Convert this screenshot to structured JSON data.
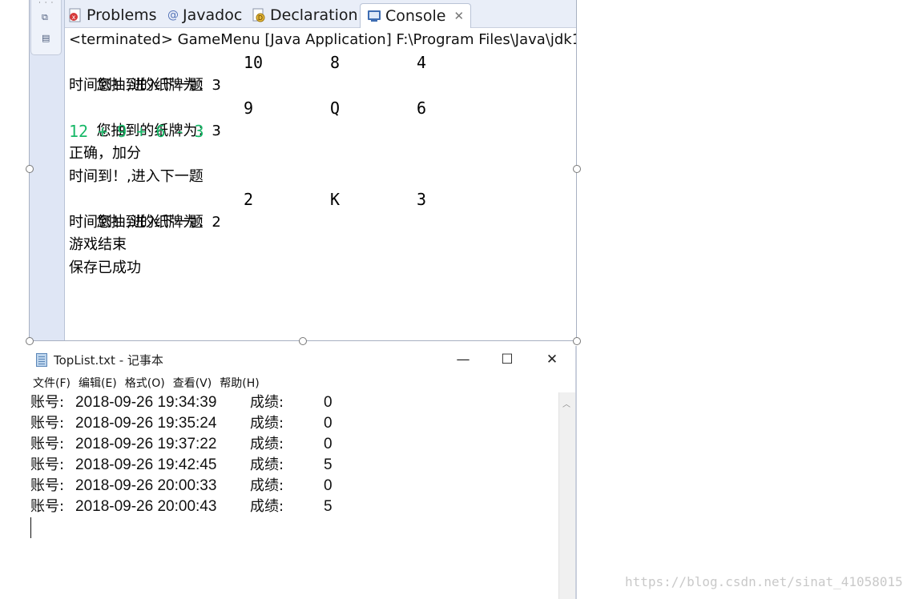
{
  "eclipse": {
    "tabs": [
      {
        "label": "Problems",
        "icon": "problems-icon"
      },
      {
        "label": "Javadoc",
        "icon": "javadoc-icon"
      },
      {
        "label": "Declaration",
        "icon": "declaration-icon"
      },
      {
        "label": "Console",
        "icon": "console-icon",
        "active": true
      }
    ],
    "console_header": "<terminated> GameMenu [Java Application] F:\\Program Files\\Java\\jdk1",
    "console_lines": [
      {
        "text": "您抽到的纸牌为：3",
        "cells": [
          "10",
          "8",
          "4"
        ]
      },
      {
        "text": "时间到！,进入下一题"
      },
      {
        "text": "您抽到的纸牌为：3",
        "cells": [
          "9",
          "Q",
          "6"
        ]
      },
      {
        "text": "12 + 9 + 6 - 3",
        "color": "#18b868"
      },
      {
        "text": "正确，加分"
      },
      {
        "text": "时间到！,进入下一题"
      },
      {
        "text": "您抽到的纸牌为：2",
        "cells": [
          "2",
          "K",
          "3"
        ]
      },
      {
        "text": "时间到！,进入下一题"
      },
      {
        "text": "游戏结束"
      },
      {
        "text": "保存已成功"
      }
    ]
  },
  "notepad": {
    "title": "TopList.txt - 记事本",
    "window_controls": {
      "minimize": "—",
      "maximize": "☐",
      "close": "✕"
    },
    "menu": [
      "文件(F)",
      "编辑(E)",
      "格式(O)",
      "查看(V)",
      "帮助(H)"
    ],
    "account_label": "账号:",
    "score_label": "成绩:",
    "rows": [
      {
        "datetime": "2018-09-26 19:34:39",
        "score": "0"
      },
      {
        "datetime": "2018-09-26 19:35:24",
        "score": "0"
      },
      {
        "datetime": "2018-09-26 19:37:22",
        "score": "0"
      },
      {
        "datetime": "2018-09-26 19:42:45",
        "score": "5"
      },
      {
        "datetime": "2018-09-26 20:00:33",
        "score": "0"
      },
      {
        "datetime": "2018-09-26 20:00:43",
        "score": "5"
      }
    ]
  },
  "watermark": "https://blog.csdn.net/sinat_41058015"
}
